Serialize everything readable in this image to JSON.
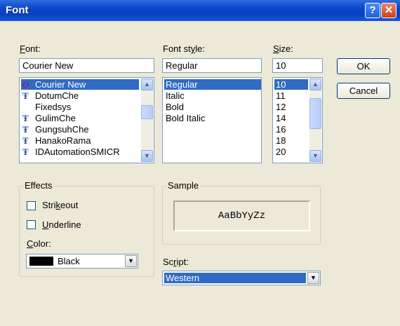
{
  "window": {
    "title": "Font",
    "help_glyph": "?",
    "close_glyph": "✕"
  },
  "font": {
    "label_u": "F",
    "label_rest": "ont:",
    "value": "Courier New",
    "items": [
      {
        "name": "Courier New",
        "icon": "O",
        "icon_name": "opentype-icon",
        "selected": true
      },
      {
        "name": "DotumChe",
        "icon": "Ŧ",
        "icon_name": "truetype-icon"
      },
      {
        "name": "Fixedsys",
        "icon": "",
        "icon_name": "none"
      },
      {
        "name": "GulimChe",
        "icon": "Ŧ",
        "icon_name": "truetype-icon"
      },
      {
        "name": "GungsuhChe",
        "icon": "Ŧ",
        "icon_name": "truetype-icon"
      },
      {
        "name": "HanakoRama",
        "icon": "Ŧ",
        "icon_name": "truetype-icon"
      },
      {
        "name": "IDAutomationSMICR",
        "icon": "Ŧ",
        "icon_name": "truetype-icon"
      }
    ]
  },
  "style": {
    "label_pre": "Font st",
    "label_u": "y",
    "label_rest": "le:",
    "value": "Regular",
    "items": [
      "Regular",
      "Italic",
      "Bold",
      "Bold Italic"
    ]
  },
  "size": {
    "label_u": "S",
    "label_rest": "ize:",
    "value": "10",
    "items": [
      "10",
      "11",
      "12",
      "14",
      "16",
      "18",
      "20"
    ]
  },
  "buttons": {
    "ok": "OK",
    "cancel": "Cancel"
  },
  "effects": {
    "group_label": "Effects",
    "strike_pre": "Stri",
    "strike_u": "k",
    "strike_rest": "eout",
    "under_u": "U",
    "under_rest": "nderline",
    "color_u": "C",
    "color_rest": "olor:",
    "color_value": "Black",
    "color_swatch": "#000000"
  },
  "sample": {
    "group_label": "Sample",
    "text": "AaBbYyZz"
  },
  "script": {
    "label_pre": "Sc",
    "label_u": "r",
    "label_rest": "ipt:",
    "value": "Western"
  },
  "colors": {
    "title_bar": "#0a46c8",
    "selection": "#316ac5",
    "dialog_bg": "#ece9d8",
    "opentype_icon": "#8b1a8b",
    "truetype_icon": "#1f4f9a"
  }
}
